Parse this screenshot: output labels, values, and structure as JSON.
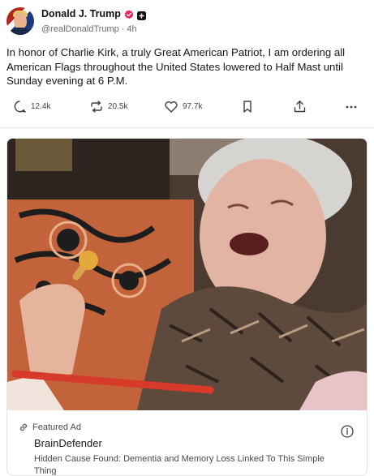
{
  "post": {
    "author": {
      "display_name": "Donald J. Trump",
      "handle": "@realDonaldTrump",
      "separator": "·",
      "time": "4h"
    },
    "text": "In honor of Charlie Kirk, a truly Great American Patriot, I am ordering all American Flags throughout the United States lowered to Half Mast until Sunday evening at 6 P.M."
  },
  "actions": {
    "replies": "12.4k",
    "reposts": "20.5k",
    "likes": "97.7k"
  },
  "ad": {
    "label": "Featured Ad",
    "sponsor": "BrainDefender",
    "headline": "Hidden Cause Found: Dementia and Memory Loss Linked To This Simple Thing"
  },
  "colors": {
    "verified_badge": "#e0245e",
    "text_primary": "#1b1b1b",
    "text_secondary": "#6b6b6b"
  }
}
